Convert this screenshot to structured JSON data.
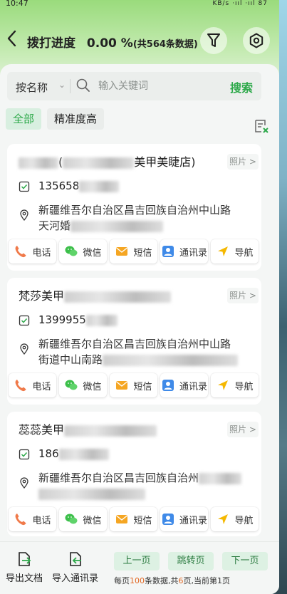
{
  "status_bar": {
    "time": "10:47",
    "right": "KB/s ·ııl ·ııl 87"
  },
  "header": {
    "back_label": "<",
    "title": "拨打进度",
    "progress": "0.00 %",
    "subtitle": "(共564条数据)"
  },
  "search": {
    "filter_label": "按名称",
    "placeholder": "输入关键词",
    "button_label": "搜索"
  },
  "tabs": [
    {
      "label": "全部",
      "active": true
    },
    {
      "label": "精准度高",
      "active": false
    }
  ],
  "cards": [
    {
      "name_visible": "美甲美睫店)",
      "name_prefix": "(",
      "photo_label": "照片 >",
      "phone": "135658",
      "address_line1": "新疆维吾尔自治区昌吉回族自治州中山路",
      "address_line2": "天河婚"
    },
    {
      "name_visible": "梵莎美甲",
      "name_prefix": "",
      "photo_label": "照片 >",
      "phone": "1399955",
      "address_line1": "新疆维吾尔自治区昌吉回族自治州中山路",
      "address_line2": "街道中山南路"
    },
    {
      "name_visible": "蕊蕊美甲",
      "name_prefix": "",
      "photo_label": "照片 >",
      "phone": "186",
      "address_line1": "新疆维吾尔自治区昌吉回族自治州",
      "address_line2": ""
    }
  ],
  "actions": [
    "电话",
    "微信",
    "短信",
    "通讯录",
    "导航"
  ],
  "footer": {
    "export_label": "导出文档",
    "import_label": "导入通讯录",
    "prev_label": "上一页",
    "jump_label": "跳转页",
    "next_label": "下一页",
    "info_prefix": "每页",
    "per_page": "100",
    "info_mid": "条数据,共",
    "total_pages": "6",
    "info_suffix": "页,当前第1页"
  },
  "colors": {
    "accent": "#2da94a",
    "header_top": "#9adb7c",
    "phone_icon": "#f07a4a",
    "wechat_icon": "#3cbf4a",
    "sms_icon": "#f5a623",
    "contacts_icon": "#3f8ae8",
    "nav_icon": "#f5b800"
  }
}
